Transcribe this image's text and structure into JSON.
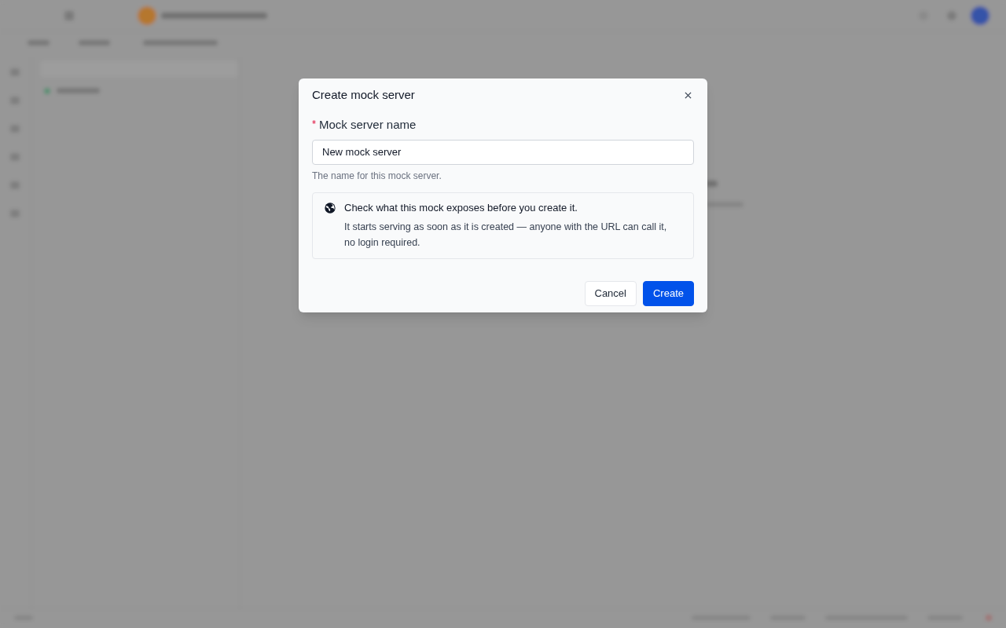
{
  "dialog": {
    "title": "Create mock server",
    "field": {
      "label": "Mock server name",
      "required": true,
      "value": "New mock server",
      "help": "The name for this mock server."
    },
    "notice": {
      "title": "Check what this mock exposes before you create it.",
      "body": "It starts serving as soon as it is created — anyone with the URL can call it, no login required."
    },
    "buttons": [
      {
        "label": "Cancel",
        "kind": "secondary"
      },
      {
        "label": "Create",
        "kind": "primary"
      }
    ]
  }
}
